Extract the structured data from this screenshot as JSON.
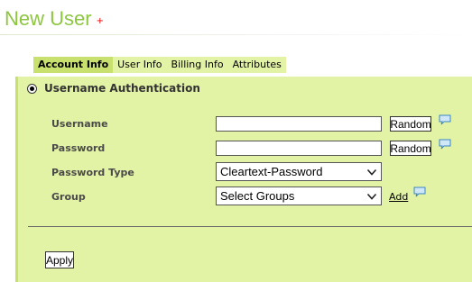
{
  "header": {
    "title": "New User",
    "required_marker": "+"
  },
  "tabs": [
    {
      "label": "Account Info",
      "active": true
    },
    {
      "label": "User Info",
      "active": false
    },
    {
      "label": "Billing Info",
      "active": false
    },
    {
      "label": "Attributes",
      "active": false
    }
  ],
  "auth": {
    "label": "Username Authentication",
    "selected": true
  },
  "form": {
    "username": {
      "label": "Username",
      "value": "",
      "random_label": "Random"
    },
    "password": {
      "label": "Password",
      "value": "",
      "random_label": "Random"
    },
    "password_type": {
      "label": "Password Type",
      "selected": "Cleartext-Password"
    },
    "group": {
      "label": "Group",
      "selected": "Select Groups",
      "add_label": "Add"
    }
  },
  "actions": {
    "apply_label": "Apply"
  },
  "colors": {
    "title": "#8dc63f",
    "panel": "#e3f3a6",
    "active_tab": "#c8e06d",
    "required_marker": "#e60000"
  },
  "icons": {
    "help": "speech-bubble-icon",
    "dropdown": "chevron-down-icon"
  }
}
